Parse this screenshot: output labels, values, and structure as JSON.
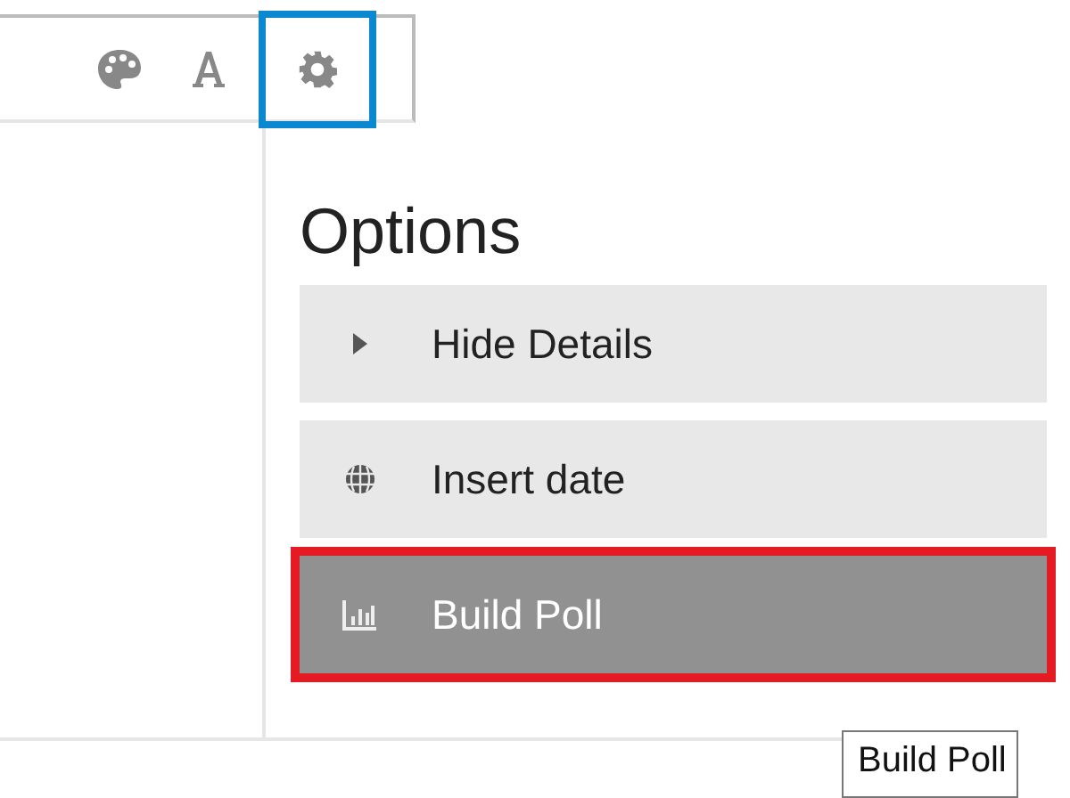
{
  "toolbar": {
    "buttons": [
      {
        "kind": "palette",
        "selected": false
      },
      {
        "kind": "font",
        "selected": false
      },
      {
        "kind": "settings",
        "selected": true
      }
    ]
  },
  "menu": {
    "title": "Options",
    "items": [
      {
        "kind": "caret",
        "label": "Hide Details",
        "selected": false
      },
      {
        "kind": "globe",
        "label": "Insert date",
        "selected": false
      },
      {
        "kind": "chart",
        "label": "Build Poll",
        "selected": true
      }
    ]
  },
  "tooltip": "Build Poll"
}
